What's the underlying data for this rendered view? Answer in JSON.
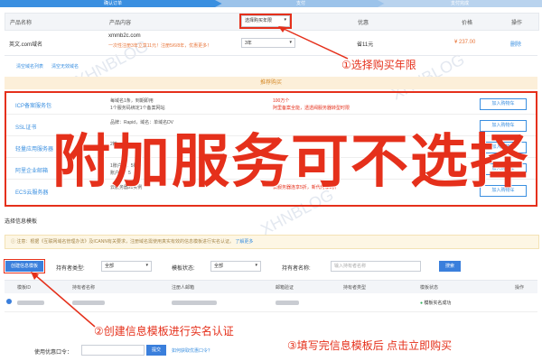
{
  "steps": [
    "确认订单",
    "支付",
    "支付完成"
  ],
  "table": {
    "headers": [
      "产品名称",
      "产品内容",
      "",
      "优惠",
      "价格",
      "操作"
    ],
    "row": {
      "name": "英文.com域名",
      "domain": "xmmb2c.com",
      "promo": "一次性注册3年立享11元！注册5/6/8年，优惠更多！",
      "years": "3年",
      "discount": "省11元",
      "price": "¥ 237.00",
      "delete": "删除"
    },
    "year_select": "选择购买年限",
    "links": [
      "清空域名列表",
      "清空无效域名"
    ]
  },
  "callouts": {
    "c1": "①选择购买年限",
    "c2": "②创建信息模板进行实名认证",
    "c3": "③填写完信息模板后 点击立即购买"
  },
  "addon": {
    "header": "推荐购买",
    "overlay": "附加服务可不选择",
    "add_label": "加入购物车",
    "items": [
      {
        "name": "ICP备案服务包",
        "d1": "每域名1条，到期即用",
        "d2": "1个服务码绑定1个备案网站",
        "d3": "100万个",
        "d4": "阿里备案全能，透透阀服务器转型时限"
      },
      {
        "name": "SSL证书",
        "d1": "品牌：Rapid，域名：单域名DV",
        "d2": "",
        "d3": "",
        "d4": ""
      },
      {
        "name": "轻量应用服务器",
        "d1": "2核",
        "d2": "",
        "d3": "",
        "d4": ""
      },
      {
        "name": "阿里企业邮箱",
        "d1": "1账户数：5账户",
        "d2": "账户数：5",
        "d3": "",
        "d4": ""
      },
      {
        "name": "ECS云服务器",
        "d1": "云服务器s1实例",
        "d2": "",
        "d3": "云服务器连享5折，新代付享8折",
        "d4": ""
      }
    ]
  },
  "template_section": {
    "title": "选择信息模板",
    "notice": "注意：根据《互联网域名管理办法》及ICANN有关要求，注册域名需使用真实有效的信息模板进行实名认证。",
    "notice_link": "了解更多",
    "create_btn": "创建信息模板",
    "filters": {
      "owner_type_label": "持有者类型:",
      "owner_type_value": "全部",
      "status_label": "模板状态:",
      "status_value": "全部",
      "owner_name_label": "持有者名称:",
      "owner_name_placeholder": "输入持有者名称",
      "search_btn": "搜索"
    },
    "columns": [
      "模板ID",
      "持有者名称",
      "注册人邮箱",
      "邮箱验证",
      "持有者类型",
      "模板状态",
      "操作"
    ],
    "row_status": "模板实名成功"
  },
  "coupon": {
    "label": "使用优惠口令：",
    "btn": "提交",
    "link": "如何获取优惠口令？"
  },
  "watermarks": [
    "XHNBLOG",
    "XHNBLOG",
    "XHNBLOG"
  ]
}
